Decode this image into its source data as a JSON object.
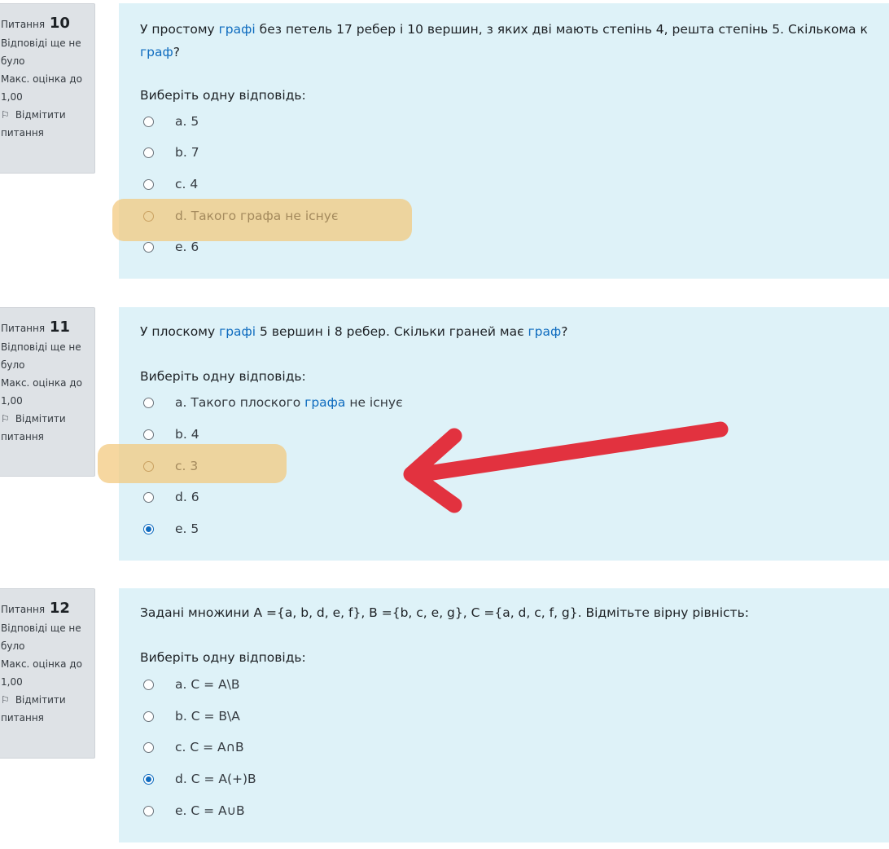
{
  "questions": [
    {
      "label": "Питання",
      "number": "10",
      "status": [
        "Відповіді ще не",
        "було"
      ],
      "grade": [
        "Макс. оцінка до",
        "1,00"
      ],
      "flag": [
        "Відмітити",
        "питання"
      ],
      "text_pre": "У простому ",
      "text_link": "графі",
      "text_mid": " без петель 17 ребер і 10 вершин, з яких дві мають степінь 4, решта степінь 5. Скількома к",
      "text_line2_link": "граф",
      "text_line2_end": "?",
      "prompt": "Виберіть одну відповідь:",
      "options": [
        "a. 5",
        "b. 7",
        "c. 4",
        "d. Такого графа не існує",
        "e. 6"
      ],
      "selected": "",
      "highlighted": "d. Такого графа не існує"
    },
    {
      "label": "Питання",
      "number": "11",
      "status": [
        "Відповіді ще не",
        "було"
      ],
      "grade": [
        "Макс. оцінка до",
        "1,00"
      ],
      "flag": [
        "Відмітити",
        "питання"
      ],
      "text_pre": "У плоскому ",
      "text_link": "графі",
      "text_mid": " 5 вершин і 8 ребер. Скільки граней має ",
      "text_link2": "граф",
      "text_end": "?",
      "prompt": "Виберіть одну відповідь:",
      "option_a_pre": "a. Такого плоского ",
      "option_a_link": "графа",
      "option_a_post": " не існує",
      "options": [
        "b. 4",
        "c. 3",
        "d. 6",
        "e. 5"
      ],
      "selected": "e. 5",
      "highlighted": "c. 3"
    },
    {
      "label": "Питання",
      "number": "12",
      "status": [
        "Відповіді ще не",
        "було"
      ],
      "grade": [
        "Макс. оцінка до",
        "1,00"
      ],
      "flag": [
        "Відмітити",
        "питання"
      ],
      "text": "Задані множини A ={a, b, d, e, f}, B ={b, c, e, g}, C ={a, d, c, f, g}. Відмітьте вірну рівність:",
      "prompt": "Виберіть одну відповідь:",
      "options": [
        "a. C = A\\B",
        "b. C = B\\A",
        "c. C = A∩B",
        "d. C = A(+)B",
        "e. C = A∪B"
      ],
      "selected": "d. C = A(+)B",
      "highlighted": ""
    }
  ],
  "colors": {
    "info_bg": "#dee2e6",
    "content_bg": "#def2f8",
    "link": "#0f6cbf",
    "highlight": "#f3c77c",
    "arrow": "#e2323f"
  },
  "icons": {
    "flag": "flag-icon",
    "arrow": "red-arrow-annotation"
  }
}
